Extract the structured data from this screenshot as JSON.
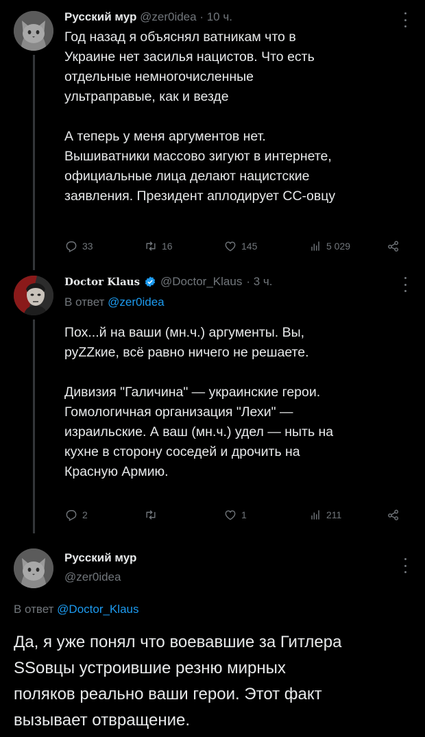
{
  "tweets": [
    {
      "author": "Русский мур",
      "handle": "@zer0idea",
      "time": "· 10 ч.",
      "text": "Год назад я объяснял ватникам что в\nУкраине нет засилья нацистов. Что есть\nотдельные немногочисленные\nультраправые, как и везде\n\nА теперь у меня аргументов нет.\nВышиватники массово зигуют в интернете,\nофициальные лица делают нацистские\nзаявления. Президент аплодирует СС-овцу",
      "stats": {
        "replies": "33",
        "retweets": "16",
        "likes": "145",
        "views": "5 029"
      }
    },
    {
      "author": "Doctor Klaus",
      "handle": "@Doctor_Klaus",
      "time": "· 3 ч.",
      "reply_prefix": "В ответ ",
      "reply_to": "@zer0idea",
      "text": "Пох...й на ваши (мн.ч.) аргументы. Вы,\nруZZкие, всё равно ничего не решаете.\n\nДивизия \"Галичина\" — украинские герои.\nГомологичная организация \"Лехи\" —\nизраильские. А ваш (мн.ч.) удел — ныть на\nкухне в сторону соседей и дрочить на\nКрасную Армию.",
      "stats": {
        "replies": "2",
        "retweets": "",
        "likes": "1",
        "views": "211"
      }
    },
    {
      "author": "Русский мур",
      "handle": "@zer0idea",
      "reply_prefix": "В ответ ",
      "reply_to": "@Doctor_Klaus",
      "text": "Да, я уже понял что воевавшие за Гитлера\nSSовцы устроившие резню мирных\nполяков реально ваши герои. Этот факт\nвызывает отвращение."
    }
  ],
  "icons": {
    "reply": "reply-icon",
    "retweet": "retweet-icon",
    "like": "heart-icon",
    "views": "views-icon",
    "share": "share-icon",
    "verified": "verified-badge-icon",
    "more": "more-icon"
  },
  "colors": {
    "background": "#000000",
    "text": "#e7e9ea",
    "secondary": "#71767b",
    "accent": "#1d9bf0"
  }
}
